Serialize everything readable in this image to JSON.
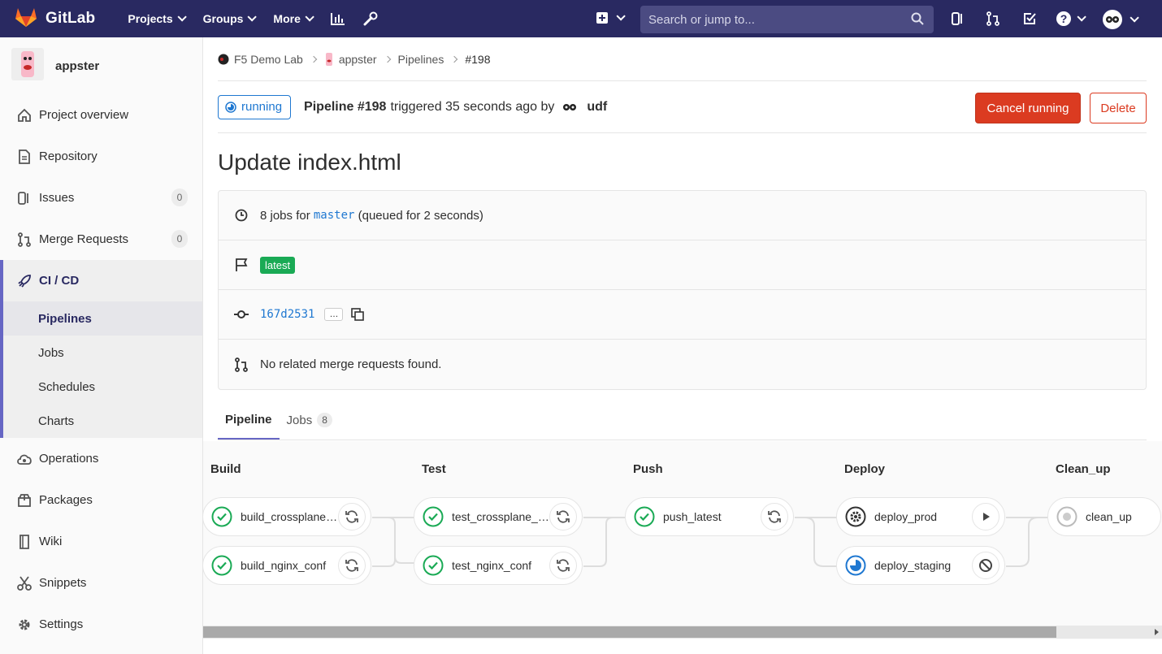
{
  "navbar": {
    "brand": "GitLab",
    "links": [
      "Projects",
      "Groups",
      "More"
    ],
    "search_placeholder": "Search or jump to..."
  },
  "sidebar": {
    "project_name": "appster",
    "items": [
      {
        "label": "Project overview",
        "icon": "home-icon"
      },
      {
        "label": "Repository",
        "icon": "doc-icon"
      },
      {
        "label": "Issues",
        "icon": "issues-icon",
        "count": "0"
      },
      {
        "label": "Merge Requests",
        "icon": "merge-request-icon",
        "count": "0"
      }
    ],
    "cicd": {
      "label": "CI / CD",
      "sub_items": [
        "Pipelines",
        "Jobs",
        "Schedules",
        "Charts"
      ]
    },
    "items_after": [
      {
        "label": "Operations",
        "icon": "cloud-gear-icon"
      },
      {
        "label": "Packages",
        "icon": "package-icon"
      },
      {
        "label": "Wiki",
        "icon": "book-icon"
      },
      {
        "label": "Snippets",
        "icon": "scissors-icon"
      },
      {
        "label": "Settings",
        "icon": "gear-icon"
      }
    ]
  },
  "breadcrumbs": [
    "F5 Demo Lab",
    "appster",
    "Pipelines",
    "#198"
  ],
  "pipeline": {
    "status": "running",
    "name": "Pipeline #198",
    "triggered_text": "triggered 35 seconds ago by",
    "user": "udf",
    "cancel_label": "Cancel running",
    "delete_label": "Delete",
    "title": "Update index.html",
    "jobs_prefix": "8 jobs for",
    "branch": "master",
    "queued_text": "(queued for 2 seconds)",
    "tag": "latest",
    "commit": "167d2531",
    "ellipsis": "…",
    "mr_text": "No related merge requests found."
  },
  "tabs": [
    {
      "label": "Pipeline"
    },
    {
      "label": "Jobs",
      "count": "8"
    }
  ],
  "stages": [
    {
      "name": "Build",
      "jobs": [
        {
          "name": "build_crossplane_conf",
          "status": "success",
          "action": "retry"
        },
        {
          "name": "build_nginx_conf",
          "status": "success",
          "action": "retry"
        }
      ]
    },
    {
      "name": "Test",
      "jobs": [
        {
          "name": "test_crossplane_nginx",
          "status": "success",
          "action": "retry"
        },
        {
          "name": "test_nginx_conf",
          "status": "success",
          "action": "retry"
        }
      ]
    },
    {
      "name": "Push",
      "jobs": [
        {
          "name": "push_latest",
          "status": "success",
          "action": "retry"
        }
      ]
    },
    {
      "name": "Deploy",
      "jobs": [
        {
          "name": "deploy_prod",
          "status": "manual",
          "action": "play"
        },
        {
          "name": "deploy_staging",
          "status": "running",
          "action": "cancel"
        }
      ]
    },
    {
      "name": "Clean_up",
      "jobs": [
        {
          "name": "clean_up",
          "status": "created",
          "action": "none"
        }
      ]
    }
  ],
  "colors": {
    "navbar": "#292961",
    "success": "#1aaa55",
    "running": "#1f78d1",
    "danger": "#db3b21",
    "active_border": "#6666c4"
  }
}
